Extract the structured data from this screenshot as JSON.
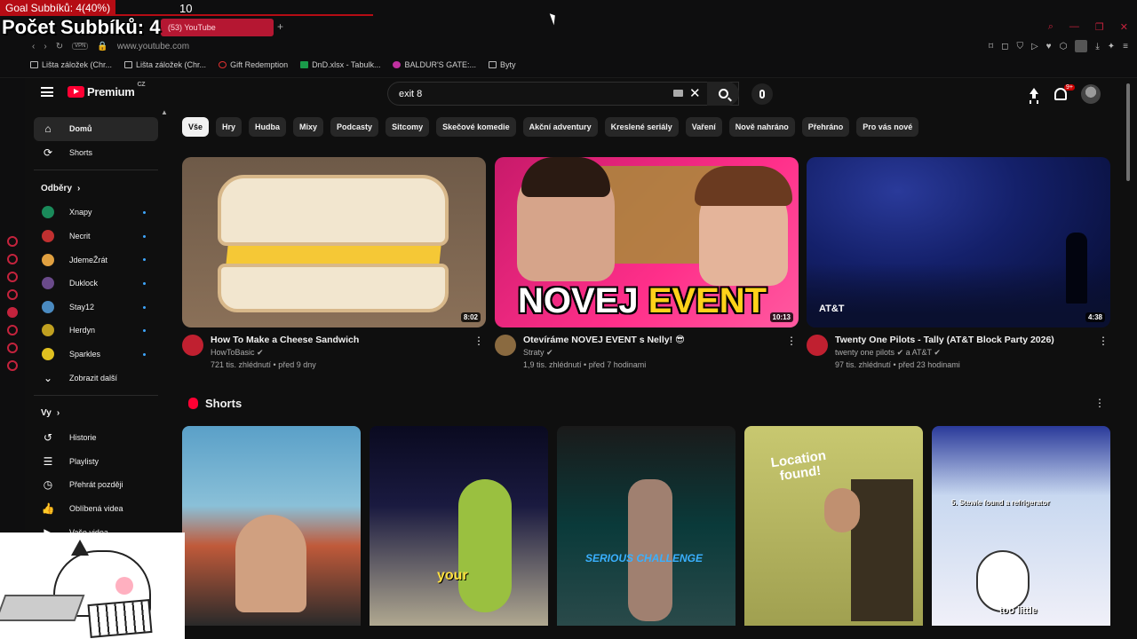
{
  "overlay": {
    "goal_label": "Goal Subbíků: 4(40%)",
    "goal_target": "10",
    "counter": "Počet Subbíků: 4"
  },
  "browser": {
    "tab_title": "(53) YouTube",
    "url": "www.youtube.com",
    "vpn_label": "VPN",
    "bookmarks": [
      "Lišta záložek (Chr...",
      "Lišta záložek (Chr...",
      "Gift Redemption",
      "DnD.xlsx - Tabulk...",
      "BALDUR'S GATE:...",
      "Byty"
    ]
  },
  "header": {
    "logo_text": "Premium",
    "logo_region": "CZ",
    "search_query": "exit 8",
    "notifications_badge": "9+"
  },
  "sidebar": {
    "main": [
      {
        "label": "Domů",
        "icon": "home-icon"
      },
      {
        "label": "Shorts",
        "icon": "shorts-icon"
      }
    ],
    "subscriptions_title": "Odběry",
    "channels": [
      {
        "label": "Xnapy",
        "color": "#1a8a5a"
      },
      {
        "label": "Necrit",
        "color": "#c03030"
      },
      {
        "label": "JdemeŽrát",
        "color": "#e0a040"
      },
      {
        "label": "Duklock",
        "color": "#6a4a8a"
      },
      {
        "label": "Stay12",
        "color": "#4a8ac0"
      },
      {
        "label": "Herdyn",
        "color": "#c0a020"
      },
      {
        "label": "Sparkles",
        "color": "#e0c020"
      }
    ],
    "show_more": "Zobrazit další",
    "you_title": "Vy",
    "you_items": [
      {
        "label": "Historie",
        "icon": "history-icon"
      },
      {
        "label": "Playlisty",
        "icon": "playlist-icon"
      },
      {
        "label": "Přehrát později",
        "icon": "clock-icon"
      },
      {
        "label": "Oblíbená videa",
        "icon": "thumbs-up-icon"
      },
      {
        "label": "Vaše videa",
        "icon": "video-icon"
      }
    ]
  },
  "chips": [
    "Vše",
    "Hry",
    "Hudba",
    "Mixy",
    "Podcasty",
    "Sitcomy",
    "Skečové komedie",
    "Akční adventury",
    "Kreslené seriály",
    "Vaření",
    "Nově nahráno",
    "Přehráno",
    "Pro vás nové"
  ],
  "videos": [
    {
      "title": "How To Make a Cheese Sandwich",
      "channel": "HowToBasic",
      "stats": "721 tis. zhlédnutí • před 9 dny",
      "duration": "8:02",
      "avatar_color": "#c02030"
    },
    {
      "title": "Otevíráme NOVEJ EVENT s Nelly! 😎",
      "channel": "Straty",
      "stats": "1,9 tis. zhlédnutí • před 7 hodinami",
      "duration": "10:13",
      "thumb_text_1": "NOVEJ",
      "thumb_text_2": "EVENT",
      "avatar_color": "#8a6a40"
    },
    {
      "title": "Twenty One Pilots - Tally (AT&T Block Party 2026)",
      "channel": "twenty one pilots",
      "channel_suffix": "a AT&T",
      "stats": "97 tis. zhlédnutí • před 23 hodinami",
      "duration": "4:38",
      "thumb_brand": "AT&T",
      "avatar_color": "#c02030"
    }
  ],
  "shorts": {
    "title": "Shorts",
    "items": [
      {
        "text": ""
      },
      {
        "text": "your"
      },
      {
        "text": "SERIOUS CHALLENGE"
      },
      {
        "text": "Location found!"
      },
      {
        "text": "too little",
        "list_caption": "5. Stewie found a refrigerator"
      }
    ]
  }
}
